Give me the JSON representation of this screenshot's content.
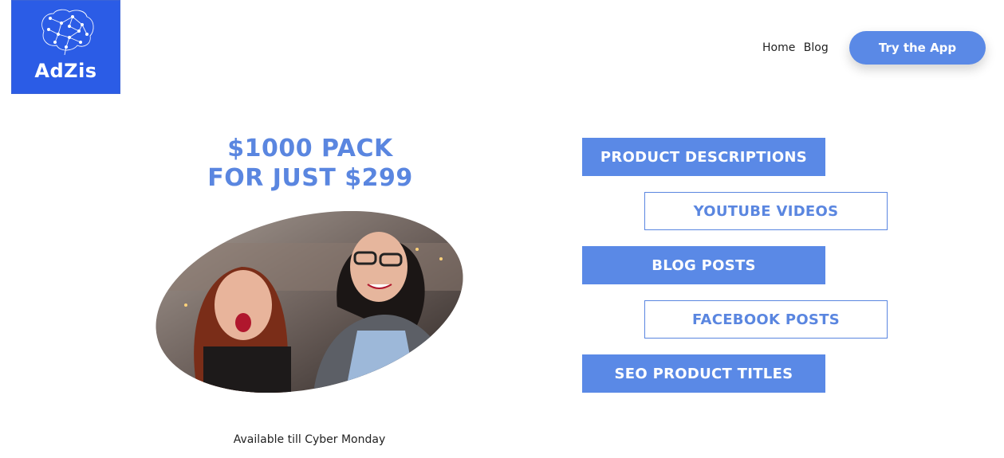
{
  "brand": {
    "name": "AdZis",
    "color": "#2b5ce6",
    "icon": "brain-network-icon"
  },
  "nav": {
    "home": "Home",
    "blog": "Blog"
  },
  "cta": {
    "label": "Try the App"
  },
  "promo": {
    "line1": "$1000 PACK",
    "line2": "FOR JUST $299",
    "caption": "Available till Cyber Monday"
  },
  "services": [
    "PRODUCT DESCRIPTIONS",
    "YOUTUBE VIDEOS",
    "BLOG POSTS",
    "FACEBOOK POSTS",
    "SEO PRODUCT TITLES"
  ],
  "colors": {
    "accent": "#5a89e6",
    "text": "#222222"
  }
}
